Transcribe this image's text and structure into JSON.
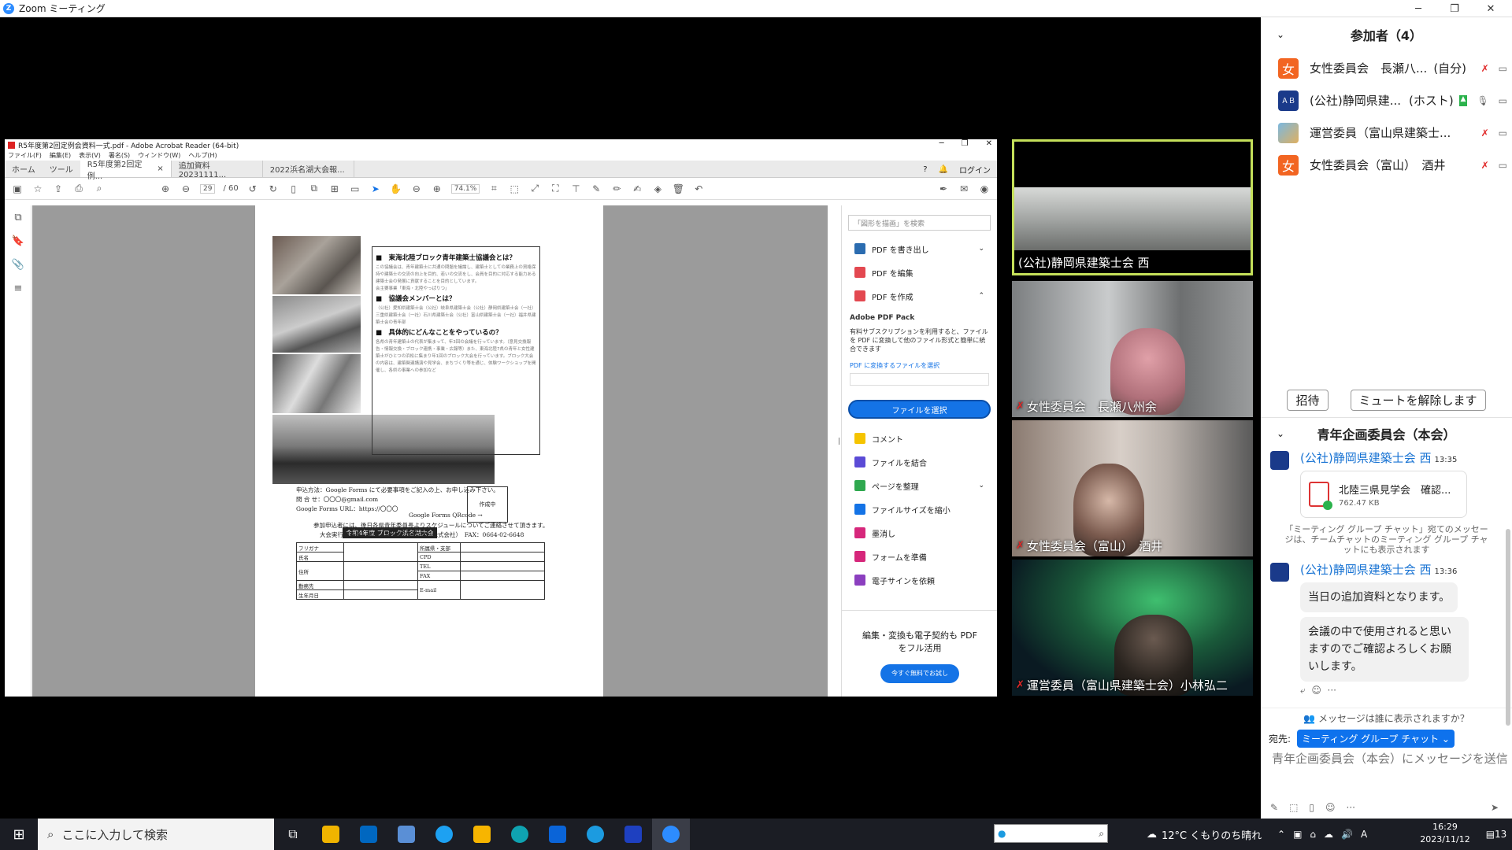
{
  "zoom": {
    "title": "Zoom ミーティング",
    "win_min": "─",
    "win_max": "❐",
    "win_close": "✕"
  },
  "acrobat": {
    "title": "R5年度第2回定例会資料一式.pdf - Adobe Acrobat Reader (64-bit)",
    "menu": [
      "ファイル(F)",
      "編集(E)",
      "表示(V)",
      "署名(S)",
      "ウィンドウ(W)",
      "ヘルプ(H)"
    ],
    "nav": [
      "ホーム",
      "ツール"
    ],
    "tabs": [
      "R5年度第2回定例...",
      "追加資料20231111...",
      "2022浜名湖大会報..."
    ],
    "tab_close": "×",
    "login": "ログイン",
    "page_current": "29",
    "page_total": "/ 60",
    "zoom": "74.1%",
    "page": {
      "box_h1": "■　東海北陸ブロック青年建築士協議会とは？",
      "box_t1": "この協議会は、青年建築士に共通の問題を議論し、建築士としての業務上の資格保持や建築士の交流の向上を目的、若いの交流をし、会員を目的に対応する能力ある建築士会の発展に貢献することを目的としています。",
      "box_t1b": "会主要事業「東海・北陸やっぱりつ」",
      "box_h2": "■　協議会メンバーとは？",
      "box_t2": "（公社）愛知県建築士会（公社）岐阜県建築士会（公社）静岡県建築士会（一社）三重県建築士会（一社）石川県建築士会（公社）富山県建築士会（一社）福井県建築士会の青年部",
      "box_h3": "■　具体的にどんなことをやっているの？",
      "box_t3": "各県の青年建築士の代表が集まって、年3回の会議を行っています。（意見交換報告・情報交換・ブロック連携・事業・広報等）また、東海北陸7県の青年と女性建築士がひとつの浜松に集まり年1回のブロック大会を行っています。ブロック大会の内容は、建築関連講演や見学会、まちづくり等を通じ、体験ワークショップを開催し、各県の事業への参加など",
      "caption": "令和4年度 ブロック浜名湖大会",
      "apply": "申込方法：Google Forms にて必要事項をご記入の上、お申し込み下さい。",
      "contact": "問 合 せ：〇〇〇@gmail.com",
      "url": "Google Forms URL：https://〇〇〇",
      "qr": "Google Forms QRcode →",
      "qrbox": "作成中",
      "notice": "参加申込者には、後日各県青年委員長よりスケジュールについてご連絡させて頂きます。",
      "chair": "大会実行委員長　榊原　幸一郎（榊原建設株式会社）　FAX：0664-02-6648",
      "form": {
        "furigana": "フリガナ",
        "name": "氏名",
        "address": "住所",
        "work": "勤務先",
        "birth": "生年月日",
        "org": "所属県・支部",
        "cpd": "CPD",
        "tel": "TEL",
        "fax": "FAX",
        "email": "E-mail"
      }
    },
    "panel": {
      "search": "「図形を描画」を検索",
      "export": "PDF を書き出し",
      "edit": "PDF を編集",
      "create": "PDF を作成",
      "pack_title": "Adobe PDF Pack",
      "pack_text": "有料サブスクリプションを利用すると、ファイルを PDF に変換して他のファイル形式と簡単に統合できます",
      "pack_link": "PDF に変換するファイルを選択",
      "select_btn": "ファイルを選択",
      "comment": "コメント",
      "combine": "ファイルを結合",
      "organize": "ページを整理",
      "compress": "ファイルサイズを縮小",
      "redact": "墨消し",
      "form": "フォームを準備",
      "sign": "電子サインを依頼",
      "promo": "編集・変換も電子契約も PDFをフル活用",
      "promo_btn": "今すぐ無料でお試し"
    }
  },
  "videos": [
    {
      "name": "(公社)静岡県建築士会 西",
      "muted": false
    },
    {
      "name": "女性委員会　長瀬八州余",
      "muted": true
    },
    {
      "name": "女性委員会（富山）　酒井",
      "muted": true
    },
    {
      "name": "運営委員（富山県建築士会）小林弘二",
      "muted": true
    }
  ],
  "participants": {
    "header": "参加者（4）",
    "items": [
      {
        "avatar": "女",
        "name": "女性委員会　長瀬八...",
        "tag": "(自分)",
        "color": "#f26522"
      },
      {
        "avatar": "",
        "name": "(公社)静岡県建...",
        "tag": "(ホスト)",
        "color": "#1a3a8a"
      },
      {
        "avatar": "",
        "name": "運営委員（富山県建築士...",
        "tag": "",
        "color": "#4a90c8"
      },
      {
        "avatar": "女",
        "name": "女性委員会（富山）　酒井",
        "tag": "",
        "color": "#f26522"
      }
    ],
    "invite": "招待",
    "unmute": "ミュートを解除します"
  },
  "chat": {
    "header": "青年企画委員会（本会）",
    "messages": [
      {
        "sender": "(公社)静岡県建築士会 西",
        "time": "13:35",
        "file_name": "北陸三県見学会　確認...",
        "file_size": "762.47 KB"
      },
      {
        "sender": "(公社)静岡県建築士会 西",
        "time": "13:36",
        "text1": "当日の追加資料となります。",
        "text2": "会議の中で使用されると思いますのでご確認よろしくお願いします。"
      }
    ],
    "notice": "「ミーティング グループ チャット」宛てのメッセージは、チームチャットのミーティング グループ チャットにも表示されます",
    "who_can_see": "メッセージは誰に表示されますか？",
    "to_label": "宛先:",
    "to_value": "ミーティング グループ チャット ⌄",
    "placeholder": "青年企画委員会（本会）にメッセージを送信"
  },
  "taskbar": {
    "search": "ここに入力して検索",
    "weather": "12°C くもりのち晴れ",
    "time": "16:29",
    "date": "2023/11/12",
    "notif": "13"
  }
}
